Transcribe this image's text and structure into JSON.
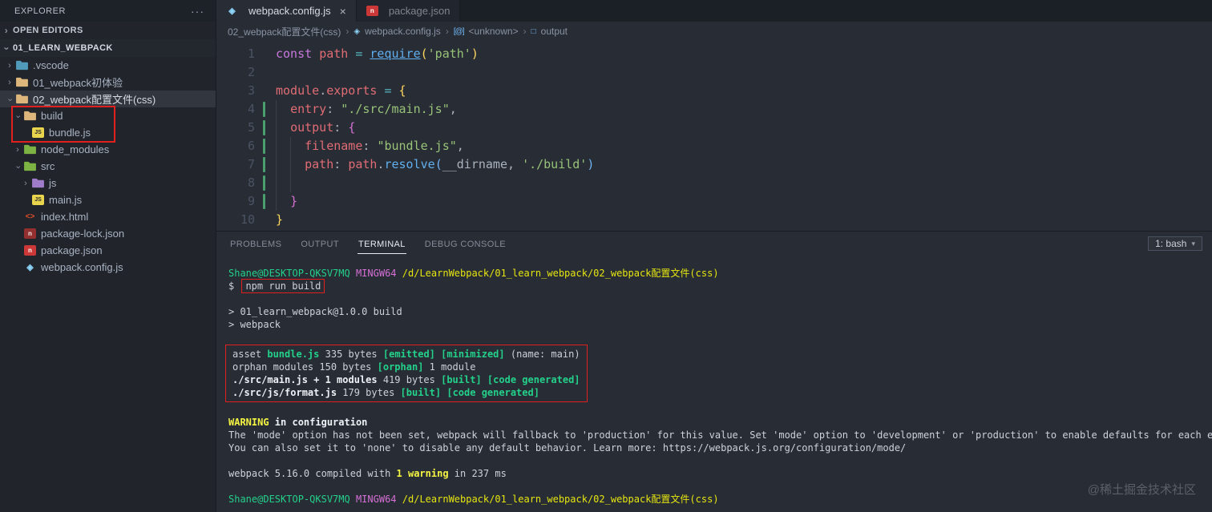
{
  "explorer": {
    "title": "EXPLORER",
    "more_actions": "···",
    "open_editors_label": "OPEN EDITORS",
    "root_label": "01_LEARN_WEBPACK",
    "tree": [
      {
        "label": ".vscode",
        "kind": "folder",
        "level": 1,
        "expanded": false,
        "color": "#519aba"
      },
      {
        "label": "01_webpack初体验",
        "kind": "folder",
        "level": 1,
        "expanded": false,
        "color": "#dcb67a"
      },
      {
        "label": "02_webpack配置文件(css)",
        "kind": "folder",
        "level": 1,
        "expanded": true,
        "color": "#dcb67a",
        "selected": true
      },
      {
        "label": "build",
        "kind": "folder",
        "level": 2,
        "expanded": true,
        "color": "#dcb67a"
      },
      {
        "label": "bundle.js",
        "kind": "js",
        "level": 3
      },
      {
        "label": "node_modules",
        "kind": "folder",
        "level": 2,
        "expanded": false,
        "color": "#7cb342"
      },
      {
        "label": "src",
        "kind": "folder",
        "level": 2,
        "expanded": true,
        "color": "#7cb342"
      },
      {
        "label": "js",
        "kind": "folder",
        "level": 3,
        "expanded": false,
        "color": "#9e7cc9"
      },
      {
        "label": "main.js",
        "kind": "js",
        "level": 3
      },
      {
        "label": "index.html",
        "kind": "html",
        "level": 2
      },
      {
        "label": "package-lock.json",
        "kind": "npm-lock",
        "level": 2
      },
      {
        "label": "package.json",
        "kind": "npm",
        "level": 2
      },
      {
        "label": "webpack.config.js",
        "kind": "webpack",
        "level": 2
      }
    ]
  },
  "tabs": [
    {
      "label": "webpack.config.js",
      "icon": "webpack-icon",
      "active": true,
      "close": "×"
    },
    {
      "label": "package.json",
      "icon": "npm-icon",
      "active": false
    }
  ],
  "breadcrumb": {
    "items": [
      "02_webpack配置文件(css)",
      "webpack.config.js",
      "<unknown>",
      "output"
    ]
  },
  "editor": {
    "lines": [
      {
        "n": 1,
        "indent": 0,
        "tokens": [
          [
            "const",
            "kw"
          ],
          [
            " ",
            "d"
          ],
          [
            "path",
            "var"
          ],
          [
            " ",
            "d"
          ],
          [
            "=",
            "op"
          ],
          [
            " ",
            "d"
          ],
          [
            "require",
            "fn u"
          ],
          [
            "(",
            "b1"
          ],
          [
            "'path'",
            "str"
          ],
          [
            ")",
            "b1"
          ]
        ]
      },
      {
        "n": 2,
        "indent": 0,
        "tokens": []
      },
      {
        "n": 3,
        "indent": 0,
        "tokens": [
          [
            "module",
            "var"
          ],
          [
            ".",
            "d"
          ],
          [
            "exports",
            "var"
          ],
          [
            " ",
            "d"
          ],
          [
            "=",
            "op"
          ],
          [
            " ",
            "d"
          ],
          [
            "{",
            "b1"
          ]
        ]
      },
      {
        "n": 4,
        "indent": 1,
        "git": true,
        "tokens": [
          [
            "entry",
            "var"
          ],
          [
            ":",
            "d"
          ],
          [
            " ",
            "d"
          ],
          [
            "\"./src/main.js\"",
            "str"
          ],
          [
            ",",
            "d"
          ]
        ]
      },
      {
        "n": 5,
        "indent": 1,
        "git": true,
        "tokens": [
          [
            "output",
            "var"
          ],
          [
            ":",
            "d"
          ],
          [
            " ",
            "d"
          ],
          [
            "{",
            "b2"
          ]
        ]
      },
      {
        "n": 6,
        "indent": 2,
        "git": true,
        "tokens": [
          [
            "filename",
            "var"
          ],
          [
            ":",
            "d"
          ],
          [
            " ",
            "d"
          ],
          [
            "\"bundle.js\"",
            "str"
          ],
          [
            ",",
            "d"
          ]
        ]
      },
      {
        "n": 7,
        "indent": 2,
        "git": true,
        "tokens": [
          [
            "path",
            "var"
          ],
          [
            ":",
            "d"
          ],
          [
            " ",
            "d"
          ],
          [
            "path",
            "var"
          ],
          [
            ".",
            "d"
          ],
          [
            "resolve",
            "fn"
          ],
          [
            "(",
            "b3"
          ],
          [
            "__dirname",
            "d"
          ],
          [
            ",",
            "d"
          ],
          [
            " ",
            "d"
          ],
          [
            "'./build'",
            "str"
          ],
          [
            ")",
            "b3"
          ]
        ]
      },
      {
        "n": 8,
        "indent": 2,
        "git": true,
        "tokens": []
      },
      {
        "n": 9,
        "indent": 1,
        "git": true,
        "tokens": [
          [
            "}",
            "b2"
          ]
        ]
      },
      {
        "n": 10,
        "indent": 0,
        "tokens": [
          [
            "}",
            "b1"
          ]
        ]
      }
    ]
  },
  "panel": {
    "tabs": [
      {
        "label": "PROBLEMS",
        "active": false
      },
      {
        "label": "OUTPUT",
        "active": false
      },
      {
        "label": "TERMINAL",
        "active": true
      },
      {
        "label": "DEBUG CONSOLE",
        "active": false
      }
    ],
    "shell_selector": "1: bash"
  },
  "terminal": {
    "lines": [
      {
        "tokens": [
          [
            "Shane@DESKTOP-QKSV7MQ",
            "g"
          ],
          [
            " ",
            "w"
          ],
          [
            "MINGW64",
            "m"
          ],
          [
            " ",
            "w"
          ],
          [
            "/d/LearnWebpack/01_learn_webpack/02_webpack配置文件(css)",
            "y"
          ]
        ]
      },
      {
        "tokens": [
          [
            "$ ",
            "w"
          ],
          [
            "npm run build",
            "w boxed"
          ]
        ]
      },
      {
        "tokens": []
      },
      {
        "tokens": [
          [
            "> 01_learn_webpack@1.0.0 build",
            "w"
          ]
        ]
      },
      {
        "tokens": [
          [
            "> webpack",
            "w"
          ]
        ]
      },
      {
        "tokens": []
      },
      {
        "box": true,
        "tokens": [
          [
            "asset ",
            "w"
          ],
          [
            "bundle.js",
            "gb"
          ],
          [
            " 335 bytes ",
            "w"
          ],
          [
            "[emitted]",
            "gb"
          ],
          [
            " ",
            "w"
          ],
          [
            "[minimized]",
            "gb"
          ],
          [
            " (name: main)",
            "w"
          ]
        ]
      },
      {
        "box": true,
        "tokens": [
          [
            "orphan modules 150 bytes ",
            "w"
          ],
          [
            "[orphan]",
            "gb"
          ],
          [
            " 1 module",
            "w"
          ]
        ]
      },
      {
        "box": true,
        "tokens": [
          [
            "./src/main.js + 1 modules",
            "wb"
          ],
          [
            " 419 bytes ",
            "w"
          ],
          [
            "[built]",
            "gb"
          ],
          [
            " ",
            "w"
          ],
          [
            "[code generated]",
            "gb"
          ]
        ]
      },
      {
        "box": true,
        "tokens": [
          [
            "./src/js/format.js",
            "wb"
          ],
          [
            " 179 bytes ",
            "w"
          ],
          [
            "[built]",
            "gb"
          ],
          [
            " ",
            "w"
          ],
          [
            "[code generated]",
            "gb"
          ]
        ]
      },
      {
        "tokens": []
      },
      {
        "tokens": [
          [
            "WARNING",
            "yb"
          ],
          [
            " in ",
            "wb"
          ],
          [
            "configuration",
            "wb"
          ]
        ]
      },
      {
        "tokens": [
          [
            "The 'mode' option has not been set, webpack will fallback to 'production' for this value. Set 'mode' option to 'development' or 'production' to enable defaults for each environment.",
            "w"
          ]
        ]
      },
      {
        "tokens": [
          [
            "You can also set it to 'none' to disable any default behavior. Learn more: https://webpack.js.org/configuration/mode/",
            "w"
          ]
        ]
      },
      {
        "tokens": []
      },
      {
        "tokens": [
          [
            "webpack 5.16.0 compiled with ",
            "w"
          ],
          [
            "1 warning",
            "yb"
          ],
          [
            " in 237 ms",
            "w"
          ]
        ]
      },
      {
        "tokens": []
      },
      {
        "tokens": [
          [
            "Shane@DESKTOP-QKSV7MQ",
            "g"
          ],
          [
            " ",
            "w"
          ],
          [
            "MINGW64",
            "m"
          ],
          [
            " ",
            "w"
          ],
          [
            "/d/LearnWebpack/01_learn_webpack/02_webpack配置文件(css)",
            "y"
          ]
        ]
      }
    ]
  },
  "watermark": "@稀土掘金技术社区"
}
